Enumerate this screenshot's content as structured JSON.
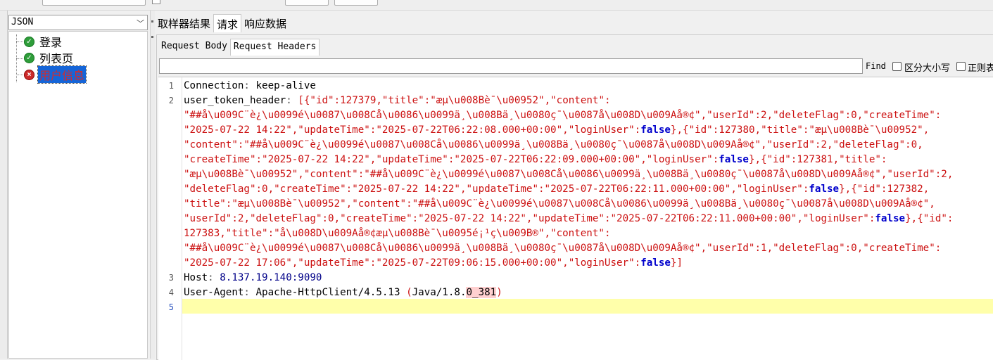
{
  "combo": {
    "value": "JSON"
  },
  "tree": [
    {
      "label": "登录",
      "status": "ok"
    },
    {
      "label": "列表页",
      "status": "ok"
    },
    {
      "label": "用户信息",
      "status": "error",
      "selected": true
    }
  ],
  "result_tabs": [
    "取样器结果",
    "请求",
    "响应数据"
  ],
  "request_tabs": [
    "Request Body",
    "Request Headers"
  ],
  "find": {
    "label": "Find",
    "case_label": "区分大小写",
    "regex_label": "正则表"
  },
  "editor": {
    "line_numbers": [
      "1",
      "2",
      "3",
      "4",
      "5"
    ],
    "header1": {
      "key": "Connection",
      "value": "keep-alive"
    },
    "header2": {
      "key": "user_token_header",
      "rows": [
        "[{\"id\":127379,\"title\":\"æµ\\u008Bè¯\\u00952\",\"content\":",
        "\"##å\\u009C¨è¿\\u0099é\\u0087\\u008Cå\\u0086\\u0099ä¸\\u008Bä¸\\u0080ç¯\\u0087å\\u008D\\u009Aå®¢\",\"userId\":2,\"deleteFlag\":0,\"createTime\":",
        "\"2025-07-22 14:22\",\"updateTime\":\"2025-07-22T06:22:08.000+00:00\",\"loginUser\":false},{\"id\":127380,\"title\":\"æµ\\u008Bè¯\\u00952\",",
        "\"content\":\"##å\\u009C¨è¿\\u0099é\\u0087\\u008Cå\\u0086\\u0099ä¸\\u008Bä¸\\u0080ç¯\\u0087å\\u008D\\u009Aå®¢\",\"userId\":2,\"deleteFlag\":0,",
        "\"createTime\":\"2025-07-22 14:22\",\"updateTime\":\"2025-07-22T06:22:09.000+00:00\",\"loginUser\":false},{\"id\":127381,\"title\":",
        "\"æµ\\u008Bè¯\\u00952\",\"content\":\"##å\\u009C¨è¿\\u0099é\\u0087\\u008Cå\\u0086\\u0099ä¸\\u008Bä¸\\u0080ç¯\\u0087å\\u008D\\u009Aå®¢\",\"userId\":2,",
        "\"deleteFlag\":0,\"createTime\":\"2025-07-22 14:22\",\"updateTime\":\"2025-07-22T06:22:11.000+00:00\",\"loginUser\":false},{\"id\":127382,",
        "\"title\":\"æµ\\u008Bè¯\\u00952\",\"content\":\"##å\\u009C¨è¿\\u0099é\\u0087\\u008Cå\\u0086\\u0099ä¸\\u008Bä¸\\u0080ç¯\\u0087å\\u008D\\u009Aå®¢\",",
        "\"userId\":2,\"deleteFlag\":0,\"createTime\":\"2025-07-22 14:22\",\"updateTime\":\"2025-07-22T06:22:11.000+00:00\",\"loginUser\":false},{\"id\":",
        "127383,\"title\":\"å\\u008D\\u009Aå®¢æµ\\u008Bè¯\\u0095é¡¹ç\\u009B®\",\"content\":",
        "\"##å\\u009C¨è¿\\u0099é\\u0087\\u008Cå\\u0086\\u0099ä¸\\u008Bä¸\\u0080ç¯\\u0087å\\u008D\\u009Aå®¢\",\"userId\":1,\"deleteFlag\":0,\"createTime\":",
        "\"2025-07-22 17:06\",\"updateTime\":\"2025-07-22T09:06:15.000+00:00\",\"loginUser\":false}]"
      ]
    },
    "header3": {
      "key": "Host",
      "value": "8.137.19.140:9090"
    },
    "header4": {
      "key": "User-Agent",
      "value": "Apache-HttpClient/4.5.13 (Java/1.8.0_381)"
    }
  }
}
